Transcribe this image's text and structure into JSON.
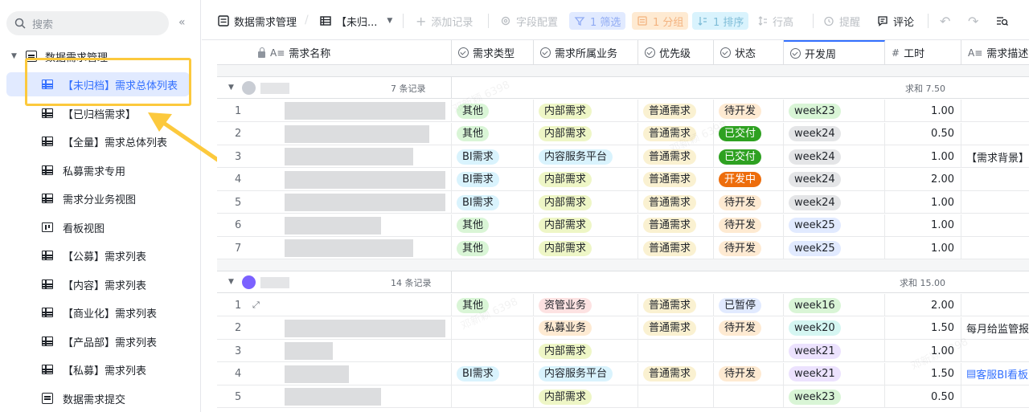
{
  "sidebar": {
    "search_placeholder": "搜索",
    "collapse_glyph": "«",
    "root_label": "数据需求管理",
    "items": [
      {
        "label": "【未归档】需求总体列表",
        "icon": "grid-icon",
        "active": true
      },
      {
        "label": "【已归档需求】",
        "icon": "grid-icon"
      },
      {
        "label": "【全量】需求总体列表",
        "icon": "grid-icon"
      },
      {
        "label": "私募需求专用",
        "icon": "grid-icon"
      },
      {
        "label": "需求分业务视图",
        "icon": "grid-icon"
      },
      {
        "label": "看板视图",
        "icon": "kanban-icon"
      },
      {
        "label": "【公募】需求列表",
        "icon": "grid-icon"
      },
      {
        "label": "【内容】需求列表",
        "icon": "grid-icon"
      },
      {
        "label": "【商业化】需求列表",
        "icon": "grid-icon"
      },
      {
        "label": "【产品部】需求列表",
        "icon": "grid-icon"
      },
      {
        "label": "【私募】需求列表",
        "icon": "grid-icon"
      },
      {
        "label": "数据需求提交",
        "icon": "form-icon"
      }
    ]
  },
  "toolbar": {
    "base_title": "数据需求管理",
    "view_name": "【未归...",
    "add_record": "添加记录",
    "field_config": "字段配置",
    "filter": "1 筛选",
    "group": "1 分组",
    "sort": "1 排序",
    "row_height": "行高",
    "remind": "提醒",
    "comment": "评论"
  },
  "columns": [
    {
      "key": "name",
      "label": "需求名称",
      "type_icon": "text"
    },
    {
      "key": "type",
      "label": "需求类型",
      "type_icon": "select"
    },
    {
      "key": "biz",
      "label": "需求所属业务",
      "type_icon": "select"
    },
    {
      "key": "priority",
      "label": "优先级",
      "type_icon": "select"
    },
    {
      "key": "status",
      "label": "状态",
      "type_icon": "select"
    },
    {
      "key": "week",
      "label": "开发周",
      "type_icon": "select"
    },
    {
      "key": "hours",
      "label": "工时",
      "type_icon": "number"
    },
    {
      "key": "desc",
      "label": "需求描述",
      "type_icon": "text"
    }
  ],
  "colors": {
    "type": {
      "其他": [
        "#d9f5d6",
        "#1f2329"
      ],
      "BI需求": [
        "#d9f3fd",
        "#1f2329"
      ]
    },
    "biz": {
      "内部需求": [
        "#eef6c6",
        "#1f2329"
      ],
      "内容服务平台": [
        "#d9f3fd",
        "#1f2329"
      ],
      "资管业务": [
        "#fde2e2",
        "#1f2329"
      ],
      "私募业务": [
        "#feead2",
        "#1f2329"
      ]
    },
    "priority": {
      "普通需求": [
        "#faf1d1",
        "#1f2329"
      ]
    },
    "status": {
      "待开发": [
        "#feead2",
        "#1f2329"
      ],
      "已交付": [
        "#2ea121",
        "#ffffff"
      ],
      "开发中": [
        "#ed6d0c",
        "#ffffff"
      ],
      "已暂停": [
        "#e1eaff",
        "#1f2329"
      ]
    },
    "week": {
      "week23": [
        "#d9f5d6",
        "#1f2329"
      ],
      "week24": [
        "#e4e5e7",
        "#1f2329"
      ],
      "week25": [
        "#e1eaff",
        "#1f2329"
      ],
      "week16": [
        "#d9f5d6",
        "#1f2329"
      ],
      "week20": [
        "#d5f6f2",
        "#1f2329"
      ],
      "week21": [
        "#ece2fe",
        "#1f2329"
      ]
    }
  },
  "groups": [
    {
      "count": "7 条记录",
      "sum": "求和 7.50",
      "avatar_color": "#c9cdd4",
      "rows": [
        {
          "n": "1",
          "type": "其他",
          "biz": "内部需求",
          "priority": "普通需求",
          "status": "待开发",
          "week": "week23",
          "hours": "1.00",
          "desc": ""
        },
        {
          "n": "2",
          "type": "其他",
          "biz": "内部需求",
          "priority": "普通需求",
          "status": "已交付",
          "week": "week24",
          "hours": "0.50",
          "desc": ""
        },
        {
          "n": "3",
          "type": "BI需求",
          "biz": "内容服务平台",
          "priority": "普通需求",
          "status": "已交付",
          "week": "week24",
          "hours": "1.00",
          "desc": "【需求背景】看"
        },
        {
          "n": "4",
          "type": "BI需求",
          "biz": "内部需求",
          "priority": "普通需求",
          "status": "开发中",
          "week": "week24",
          "hours": "2.00",
          "desc": ""
        },
        {
          "n": "5",
          "type": "BI需求",
          "biz": "内部需求",
          "priority": "普通需求",
          "status": "待开发",
          "week": "week24",
          "hours": "1.00",
          "desc": ""
        },
        {
          "n": "6",
          "type": "其他",
          "biz": "内部需求",
          "priority": "普通需求",
          "status": "待开发",
          "week": "week25",
          "hours": "1.00",
          "desc": ""
        },
        {
          "n": "7",
          "type": "其他",
          "biz": "内部需求",
          "priority": "普通需求",
          "status": "待开发",
          "week": "week25",
          "hours": "1.00",
          "desc": ""
        }
      ]
    },
    {
      "count": "14 条记录",
      "sum": "求和 15.00",
      "avatar_color": "#7b61ff",
      "rows": [
        {
          "n": "1",
          "type": "其他",
          "biz": "资管业务",
          "priority": "普通需求",
          "status": "已暂停",
          "week": "week16",
          "hours": "2.00",
          "desc": ""
        },
        {
          "n": "2",
          "type": "",
          "biz": "私募业务",
          "priority": "普通需求",
          "status": "待开发",
          "week": "week20",
          "hours": "1.50",
          "desc": "每月给监管报送"
        },
        {
          "n": "3",
          "type": "",
          "biz": "内部需求",
          "priority": "",
          "status": "",
          "week": "week21",
          "hours": "1.00",
          "desc": ""
        },
        {
          "n": "4",
          "type": "BI需求",
          "biz": "内容服务平台",
          "priority": "普通需求",
          "status": "待开发",
          "week": "week21",
          "hours": "1.50",
          "desc": "客服BI看板"
        },
        {
          "n": "5",
          "type": "",
          "biz": "内部需求",
          "priority": "",
          "status": "",
          "week": "week23",
          "hours": "0.50",
          "desc": ""
        }
      ]
    }
  ]
}
